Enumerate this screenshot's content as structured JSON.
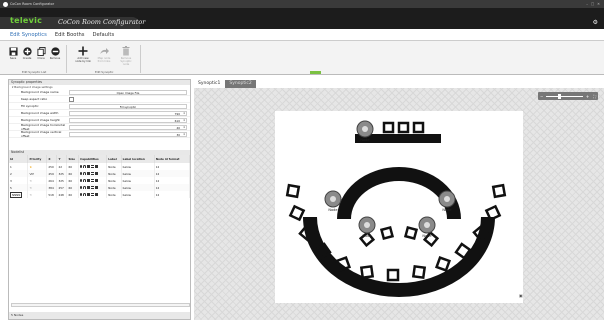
{
  "window": {
    "title": "CoCon Room Configurator",
    "controls": [
      "–",
      "□",
      "✕"
    ]
  },
  "brand": {
    "logo": "televic",
    "title": "CoCon Room Configurator"
  },
  "menu": {
    "items": [
      "Edit Synoptics",
      "Edit Booths",
      "Defaults"
    ],
    "active_index": 0
  },
  "ribbon": {
    "buttons": [
      {
        "label": "Save",
        "icon": "save-icon",
        "disabled": false
      },
      {
        "label": "Create",
        "icon": "add-circle-icon",
        "disabled": false
      },
      {
        "label": "Clone",
        "icon": "copy-icon",
        "disabled": false
      },
      {
        "label": "Remove",
        "icon": "remove-circle-icon",
        "disabled": false
      },
      {
        "label": "Add new node by link",
        "icon": "plus-icon",
        "disabled": false
      },
      {
        "label": "Map node from links",
        "icon": "arrow-icon",
        "disabled": true
      },
      {
        "label": "Remove Synoptic node",
        "icon": "trash-icon",
        "disabled": true
      }
    ],
    "groups": [
      "Edit Synoptic List",
      "Edit Synoptic"
    ]
  },
  "synoptic_properties": {
    "header": "Synoptic properties",
    "subheader": "Background image settings",
    "rows": [
      {
        "label": "Background image name",
        "value": "Open Image File",
        "type": "button"
      },
      {
        "label": "Keep aspect ratio",
        "value": "",
        "type": "checkbox"
      },
      {
        "label": "Fill synoptic",
        "value": "Fill synoptic",
        "type": "button"
      },
      {
        "label": "Background image width",
        "value": "790",
        "type": "number"
      },
      {
        "label": "Background image height",
        "value": "610",
        "type": "number"
      },
      {
        "label": "Background image horizontal offset",
        "value": "40",
        "type": "number"
      },
      {
        "label": "Background image vertical offset",
        "value": "30",
        "type": "number"
      }
    ]
  },
  "nodelist": {
    "header": "Nodelist",
    "columns": [
      "Id",
      "Priority",
      "X",
      "Y",
      "Size",
      "Capabilities",
      "Label",
      "Label location",
      "Node id format"
    ],
    "rows": [
      {
        "id": "1",
        "priority": "★",
        "x": "250",
        "y": "22",
        "size": "60",
        "label": "Node",
        "location": "below",
        "format": "12"
      },
      {
        "id": "2",
        "priority": "VIP",
        "x": "459",
        "y": "325",
        "size": "60",
        "label": "Node",
        "location": "below",
        "format": "12"
      },
      {
        "id": "3",
        "priority": "☆",
        "x": "264",
        "y": "325",
        "size": "60",
        "label": "Node",
        "location": "below",
        "format": "12"
      },
      {
        "id": "5",
        "priority": "☆",
        "x": "384",
        "y": "257",
        "size": "60",
        "label": "Node",
        "location": "below",
        "format": "12"
      },
      {
        "id": "NNNN",
        "priority": "☆",
        "x": "518",
        "y": "248",
        "size": "60",
        "label": "Node",
        "location": "below",
        "format": "12"
      }
    ]
  },
  "status": {
    "text": "5 Nodes"
  },
  "tabs": [
    "Synoptic1",
    "Synoptic2"
  ],
  "zoom": {
    "minus": "−",
    "plus": "+",
    "fit": "⛶",
    "level": 0.3
  },
  "canvas": {
    "node_label": "Node"
  },
  "colors": {
    "accent": "#7bc142",
    "brand": "#1c1c1c",
    "active_menu": "#2f6fb5",
    "star": "#f0a000"
  }
}
